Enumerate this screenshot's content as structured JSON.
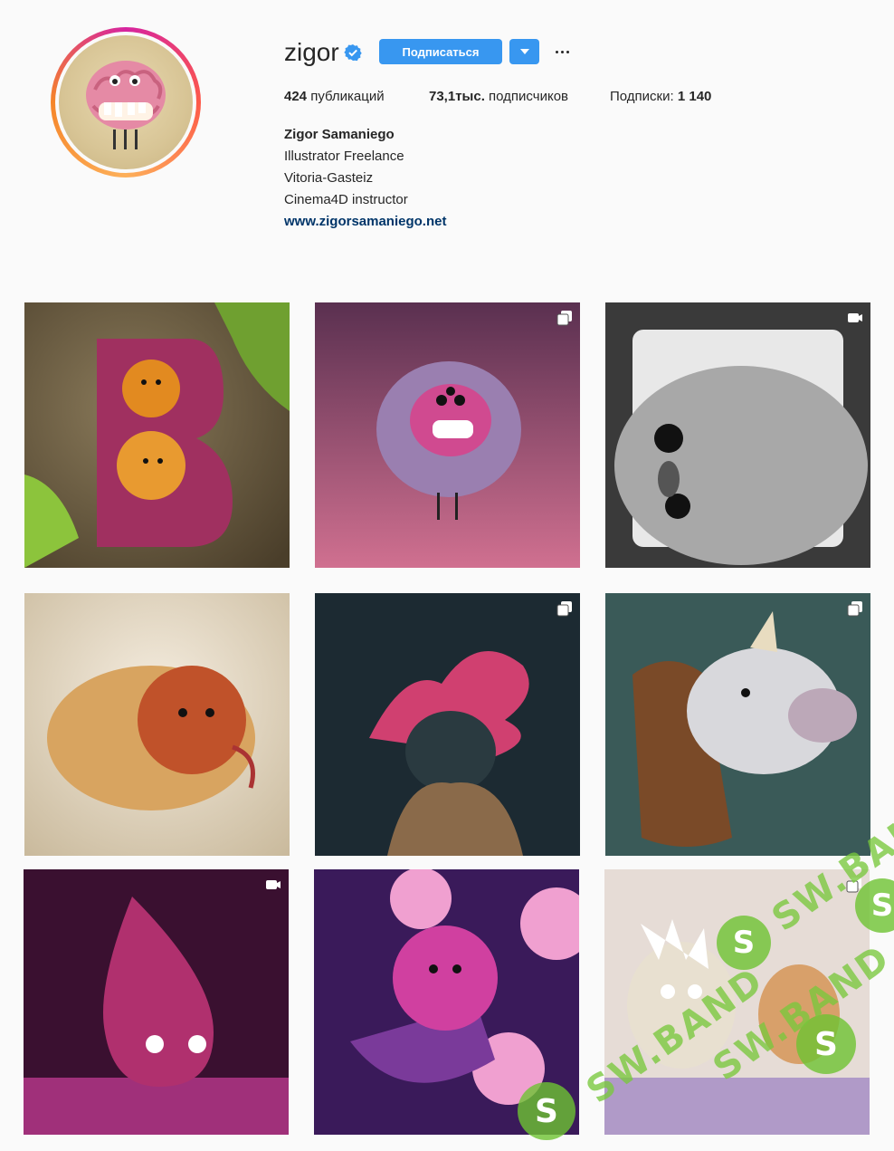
{
  "profile": {
    "username": "zigor",
    "verified": true,
    "follow_label": "Подписаться",
    "stats": {
      "posts_count": "424",
      "posts_label": "публикаций",
      "followers_count": "73,1тыс.",
      "followers_label": "подписчиков",
      "following_label": "Подписки:",
      "following_count": "1 140"
    },
    "bio": {
      "full_name": "Zigor Samaniego",
      "lines": [
        "Illustrator Freelance",
        "Vitoria-Gasteiz",
        "Cinema4D instructor"
      ],
      "website": "www.zigorsamaniego.net"
    }
  },
  "posts": [
    {
      "subject": "fuzzy letter B monster in grass",
      "badge": "none"
    },
    {
      "subject": "purple furry ball creature",
      "badge": "carousel"
    },
    {
      "subject": "grey creature in frame",
      "badge": "video"
    },
    {
      "subject": "potato creature",
      "badge": "none"
    },
    {
      "subject": "woman with pink tentacle mask",
      "badge": "carousel"
    },
    {
      "subject": "unicorn trophy head",
      "badge": "carousel"
    },
    {
      "subject": "pink drop creature",
      "badge": "video"
    },
    {
      "subject": "pink furry creature with lights",
      "badge": "none"
    },
    {
      "subject": "Rick and Morty figures",
      "badge": "carousel"
    }
  ],
  "watermark": {
    "text": "SW.BAND",
    "glyph": "S"
  },
  "colors": {
    "accent": "#3897f0",
    "link": "#003569",
    "verified": "#3897f0"
  },
  "icons": {
    "verified": "verified-badge-icon",
    "more": "more-options-icon",
    "dropdown": "chevron-down-icon",
    "carousel": "carousel-icon",
    "video": "video-icon"
  }
}
